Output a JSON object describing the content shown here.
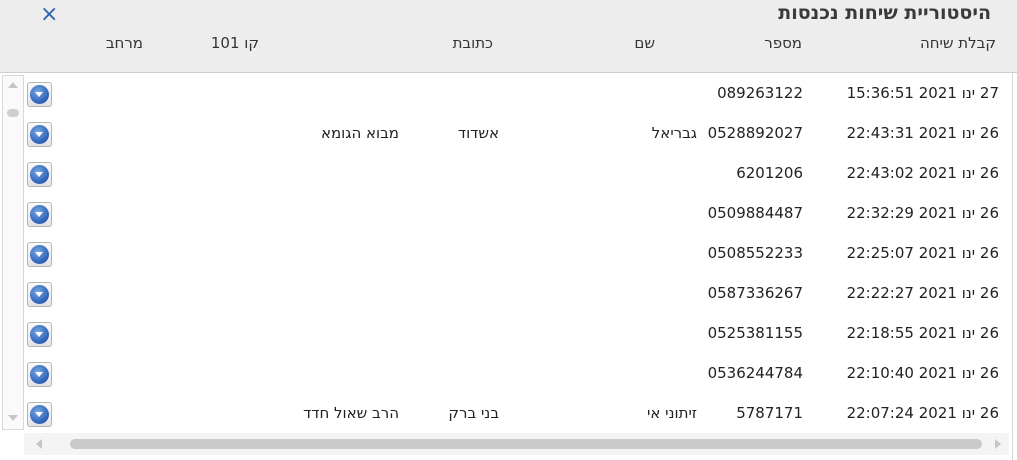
{
  "window": {
    "title": "היסטוריית שיחות נכנסות",
    "close_icon": "×"
  },
  "columns": {
    "received": "קבלת שיחה",
    "number": "מספר",
    "name": "שם",
    "address": "כתובת",
    "line": "קו 101",
    "extension": "מרחב"
  },
  "rows": [
    {
      "date": "27 ינו 2021 15:36:51",
      "number": "089263122",
      "name": "",
      "city": "",
      "street": ""
    },
    {
      "date": "26 ינו 2021 22:43:31",
      "number": "0528892027",
      "name": "גבריאל",
      "city": "אשדוד",
      "street": "מבוא הגומא"
    },
    {
      "date": "26 ינו 2021 22:43:02",
      "number": "6201206",
      "name": "",
      "city": "",
      "street": ""
    },
    {
      "date": "26 ינו 2021 22:32:29",
      "number": "0509884487",
      "name": "",
      "city": "",
      "street": ""
    },
    {
      "date": "26 ינו 2021 22:25:07",
      "number": "0508552233",
      "name": "",
      "city": "",
      "street": ""
    },
    {
      "date": "26 ינו 2021 22:22:27",
      "number": "0587336267",
      "name": "",
      "city": "",
      "street": ""
    },
    {
      "date": "26 ינו 2021 22:18:55",
      "number": "0525381155",
      "name": "",
      "city": "",
      "street": ""
    },
    {
      "date": "26 ינו 2021 22:10:40",
      "number": "0536244784",
      "name": "",
      "city": "",
      "street": ""
    },
    {
      "date": "26 ינו 2021 22:07:24",
      "number": "5787171",
      "name": "זיתוני אי",
      "city": "בני ברק",
      "street": "הרב שאול חדד"
    }
  ],
  "colors": {
    "accent": "#2f63b0",
    "header_bg": "#ededed"
  }
}
